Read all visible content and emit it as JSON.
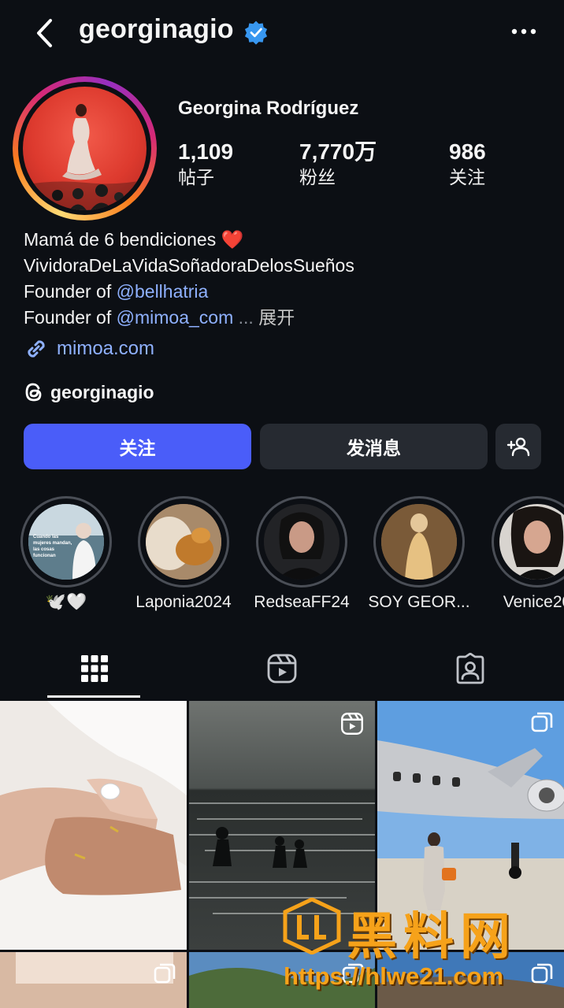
{
  "header": {
    "username": "georginagio",
    "back_icon": "chevron-left-icon",
    "verified_icon": "verified-badge-icon",
    "more_icon": "more-horizontal-icon",
    "verified_color": "#3897f0"
  },
  "profile": {
    "full_name": "Georgina Rodríguez",
    "stats": [
      {
        "value": "1,109",
        "label": "帖子"
      },
      {
        "value": "7,770万",
        "label": "粉丝"
      },
      {
        "value": "986",
        "label": "关注"
      }
    ],
    "bio": {
      "line1_text": "Mamá de 6 bendiciones ",
      "line1_emoji": "❤️",
      "line2": "VividoraDeLaVidaSoñadoraDelosSueños",
      "line3_prefix": "Founder of ",
      "line3_mention": "@bellhatria",
      "line4_prefix": "Founder of ",
      "line4_mention": "@mimoa_com",
      "ellipsis": " ...",
      "expand": "展开"
    },
    "link": "mimoa.com",
    "threads_handle": "georginagio"
  },
  "actions": {
    "follow": "关注",
    "message": "发消息",
    "add_user_icon": "add-user-icon",
    "follow_color": "#4a5df9"
  },
  "highlights": [
    {
      "label": "🕊️🤍",
      "cover_text": "Cuando las mujeres mandan, las cosas funcionan"
    },
    {
      "label": "Laponia2024"
    },
    {
      "label": "RedseaFF24"
    },
    {
      "label": "SOY GEOR..."
    },
    {
      "label": "Venice20"
    }
  ],
  "tabs": [
    {
      "name": "posts",
      "icon": "grid-icon",
      "active": true
    },
    {
      "name": "reels",
      "icon": "reels-icon",
      "active": false
    },
    {
      "name": "tagged",
      "icon": "tagged-person-icon",
      "active": false
    }
  ],
  "watermark": {
    "title": "黑料网",
    "url": "https://hlwe21.com"
  }
}
